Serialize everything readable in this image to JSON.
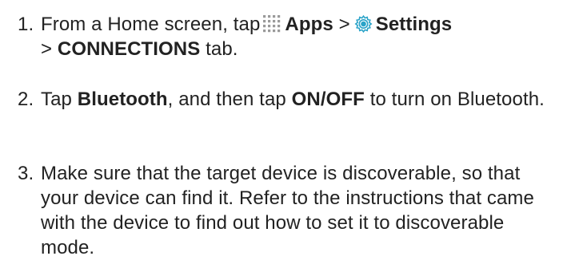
{
  "steps": [
    {
      "number": "1.",
      "t1": "From a Home screen, tap",
      "apps_icon": "apps-grid-icon",
      "apps": "Apps",
      "sep1": ">",
      "settings_icon": "settings-gear-icon",
      "settings": "Settings",
      "sep2": ">",
      "connections": "CONNECTIONS",
      "t2": "tab."
    },
    {
      "number": "2.",
      "t1": "Tap",
      "bluetooth": "Bluetooth",
      "t2": ", and then tap",
      "onoff": "ON/OFF",
      "t3": "to turn on Bluetooth."
    },
    {
      "number": "3.",
      "text": "Make sure that the target device is discoverable, so that your device can find it. Refer to the instructions that came with the device to find out how to set it to discoverable mode."
    }
  ],
  "colors": {
    "text": "#222222",
    "apps_icon": "#9a9a9a",
    "settings_icon": "#2aa3c8"
  }
}
